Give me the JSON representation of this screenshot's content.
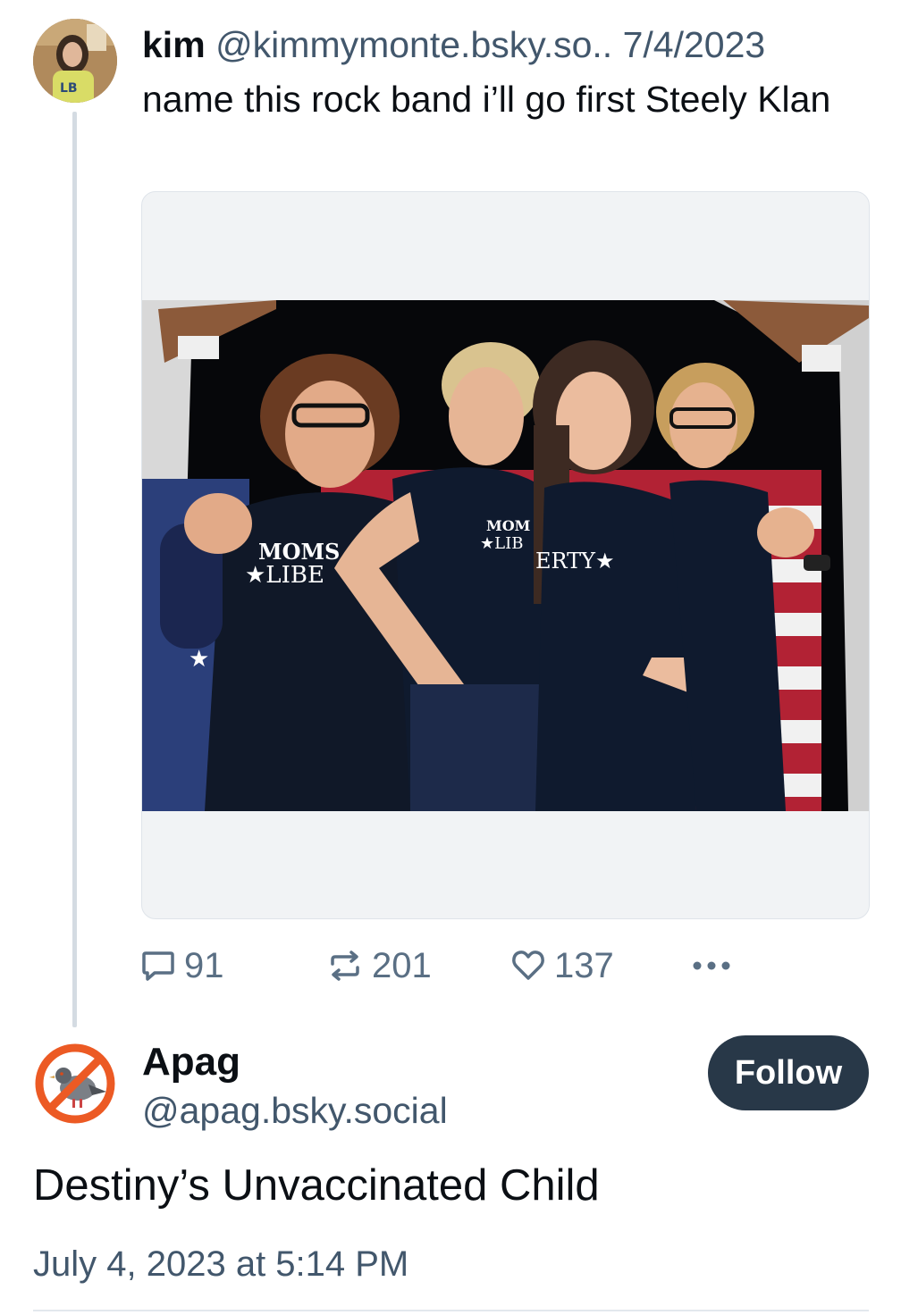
{
  "parent_post": {
    "author_name": "kim",
    "author_handle": "@kimmymonte.bsky.so..",
    "separator": " ",
    "date": "7/4/2023",
    "text": "name this rock band i’ll go first Steely Klan",
    "avatar_icon": "user-avatar-photo",
    "image": {
      "kind": "photo",
      "shirt_text_1": "MOMS",
      "shirt_text_2": "★LIBE",
      "shirt_text_3": "★LIB",
      "shirt_text_4": "ERTY★"
    },
    "stats": {
      "replies": "91",
      "reposts": "201",
      "likes": "137"
    },
    "icons": {
      "reply": "reply-bubble-icon",
      "repost": "repost-icon",
      "like": "heart-icon",
      "more": "more-horizontal-icon"
    }
  },
  "reply_post": {
    "author_name": "Apag",
    "author_handle": "@apag.bsky.social",
    "follow_label": "Follow",
    "text": "Destiny’s Unvaccinated Child",
    "timestamp": "July 4, 2023 at 5:14 PM",
    "avatar_icon": "no-pigeons-sign-icon"
  },
  "colors": {
    "text_primary": "#0b0f14",
    "text_secondary": "#42576c",
    "icon_gray": "#5a6f84",
    "follow_bg": "#283848",
    "thread_line": "#d4dbe2",
    "card_bg": "#f1f3f5",
    "no_sign_orange": "#ec5a24"
  }
}
